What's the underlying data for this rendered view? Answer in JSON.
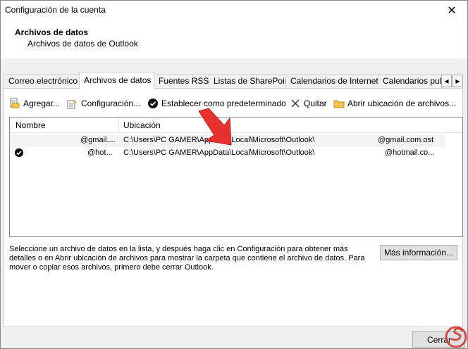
{
  "window": {
    "title": "Configuración de la cuenta",
    "close": "✕"
  },
  "header": {
    "title": "Archivos de datos",
    "subtitle": "Archivos de datos de Outlook"
  },
  "tabs": [
    {
      "label": "Correo electrónico"
    },
    {
      "label": "Archivos de datos"
    },
    {
      "label": "Fuentes RSS"
    },
    {
      "label": "Listas de SharePoint"
    },
    {
      "label": "Calendarios de Internet"
    },
    {
      "label": "Calendarios pul"
    }
  ],
  "tab_scroll": {
    "left": "◀",
    "right": "▶"
  },
  "toolbar": {
    "add": "Agregar...",
    "settings": "Configuración...",
    "set_default": "Establecer como predeterminado",
    "remove": "Quitar",
    "open_location": "Abrir ubicación de archivos..."
  },
  "list": {
    "columns": {
      "name": "Nombre",
      "location": "Ubicación"
    },
    "rows": [
      {
        "name": "@gmail....",
        "location": "C:\\Users\\PC GAMER\\AppData\\Local\\Microsoft\\Outlook\\",
        "file": "@gmail.com.ost",
        "default": false
      },
      {
        "name": "@hot...",
        "location": "C:\\Users\\PC GAMER\\AppData\\Local\\Microsoft\\Outlook\\",
        "file": "@hotmail.co...",
        "default": true
      }
    ]
  },
  "info": {
    "text": "Seleccione un archivo de datos en la lista, y después haga clic en Configuración para obtener más detalles o en Abrir ubicación de archivos para mostrar la carpeta que contiene el archivo de datos. Para mover o copiar esos archivos, primero debe cerrar Outlook.",
    "more_button": "Más información..."
  },
  "footer": {
    "close_button": "Cerrar"
  },
  "colors": {
    "arrow": "#e8312f",
    "selected_row": "#f3f3f3"
  }
}
